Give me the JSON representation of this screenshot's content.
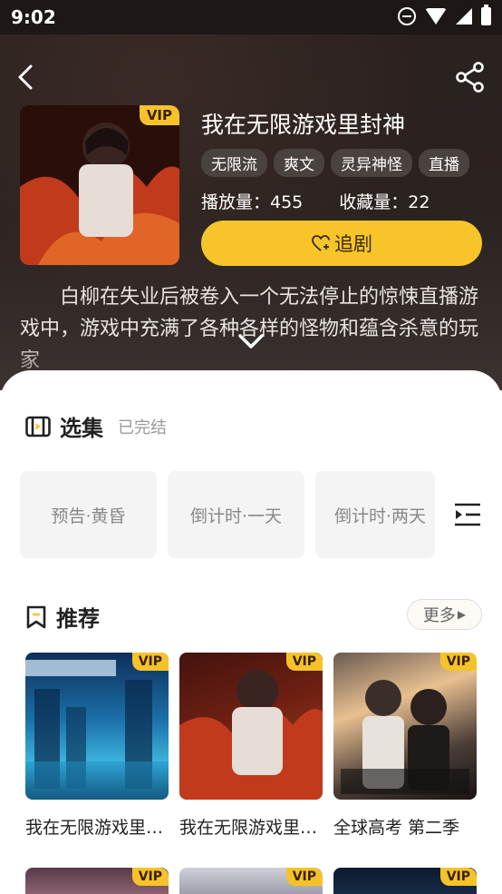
{
  "status_bar": {
    "time": "9:02"
  },
  "detail": {
    "title": "我在无限游戏里封神",
    "vip_label": "VIP",
    "tags": [
      "无限流",
      "爽文",
      "灵异神怪",
      "直播"
    ],
    "play_count_label": "播放量：455",
    "fav_count_label": "收藏量：22",
    "follow_label": "追剧",
    "description": "白柳在失业后被卷入一个无法停止的惊悚直播游戏中，游戏中充满了各种各样的怪物和蕴含杀意的玩家",
    "cover_colors": {
      "primary": "#b8321c",
      "accent": "#e8602a"
    }
  },
  "episodes": {
    "title": "选集",
    "status": "已完结",
    "items": [
      "预告·黄昏",
      "倒计时·一天",
      "倒计时·两天"
    ]
  },
  "recommend": {
    "title": "推荐",
    "more_label": "更多",
    "items": [
      {
        "name": "我在无限游戏里封神",
        "vip": "VIP"
      },
      {
        "name": "我在无限游戏里封神",
        "vip": "VIP"
      },
      {
        "name": "全球高考 第二季",
        "vip": "VIP"
      }
    ],
    "row2_vips": [
      "VIP",
      "VIP",
      "VIP"
    ]
  },
  "colors": {
    "accent": "#f7c52a",
    "hero_bg": "#2b2320"
  }
}
